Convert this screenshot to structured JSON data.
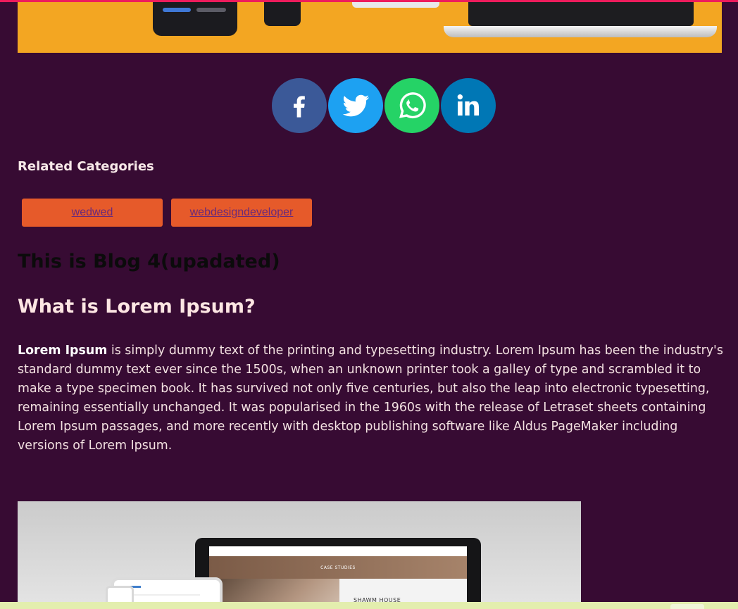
{
  "colors": {
    "background": "#370b33",
    "accent_top_line": "#ee1c5c",
    "tag_background": "#e65a2a",
    "facebook": "#3b5998",
    "twitter": "#1da1f2",
    "whatsapp": "#25d366",
    "linkedin": "#0077b5"
  },
  "hero_image": {
    "icon": "devices-hero-image"
  },
  "share": {
    "buttons": [
      {
        "icon": "facebook-icon"
      },
      {
        "icon": "twitter-icon"
      },
      {
        "icon": "whatsapp-icon"
      },
      {
        "icon": "linkedin-icon"
      }
    ]
  },
  "related": {
    "title": "Related Categories",
    "tags": [
      "wedwed",
      "webdesigndeveloper"
    ]
  },
  "blog": {
    "title": "This is Blog 4(upadated)",
    "section_heading": "What is Lorem Ipsum?",
    "paragraph_bold": "Lorem Ipsum",
    "paragraph_rest": " is simply dummy text of the printing and typesetting industry. Lorem Ipsum has been the industry's standard dummy text ever since the 1500s, when an unknown printer took a galley of type and scrambled it to make a type specimen book. It has survived not only five centuries, but also the leap into electronic typesetting, remaining essentially unchanged. It was popularised in the 1960s with the release of Letraset sheets containing Lorem Ipsum passages, and more recently with desktop publishing software like Aldus PageMaker including versions of Lorem Ipsum."
  },
  "second_image": {
    "screen_banner": "CASE STUDIES",
    "screen_heading": "SHAWM HOUSE"
  }
}
